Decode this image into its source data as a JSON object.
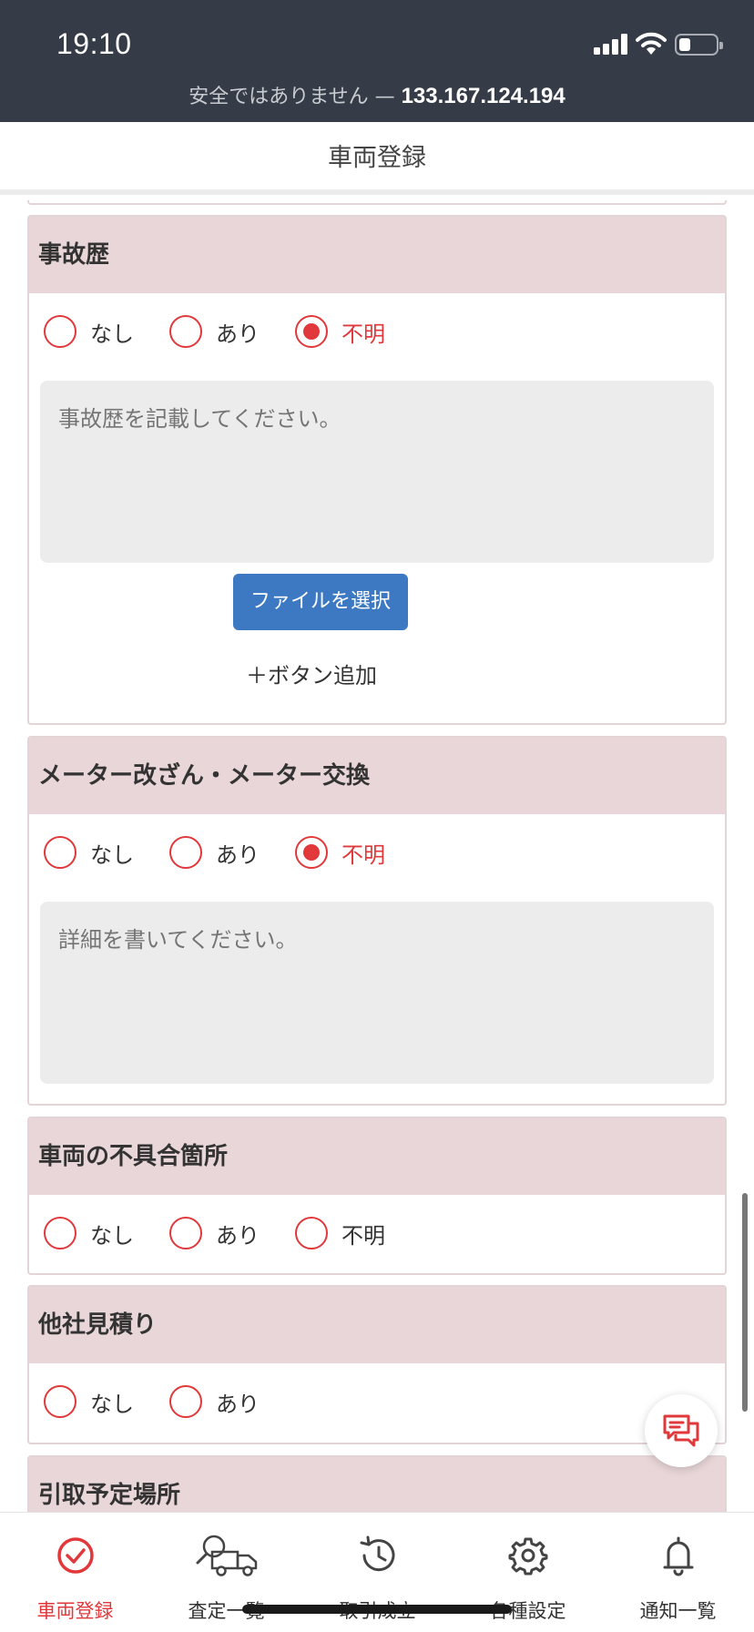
{
  "status_bar": {
    "time": "19:10"
  },
  "browser": {
    "insecure_text": "安全ではありません —",
    "host": "133.167.124.194"
  },
  "header": {
    "title": "車両登録"
  },
  "sections": [
    {
      "title": "事故歴",
      "options": [
        "なし",
        "あり",
        "不明"
      ],
      "selected": "不明",
      "placeholder": "事故歴を記載してください。",
      "file_button": "ファイルを選択",
      "add_button": "＋ボタン追加"
    },
    {
      "title": "メーター改ざん・メーター交換",
      "options": [
        "なし",
        "あり",
        "不明"
      ],
      "selected": "不明",
      "placeholder": "詳細を書いてください。"
    },
    {
      "title": "車両の不具合箇所",
      "options": [
        "なし",
        "あり",
        "不明"
      ],
      "selected": ""
    },
    {
      "title": "他社見積り",
      "options": [
        "なし",
        "あり"
      ],
      "selected": ""
    },
    {
      "title": "引取予定場所"
    }
  ],
  "nav": {
    "items": [
      {
        "label": "車両登録",
        "icon": "check-circle-icon",
        "active": true
      },
      {
        "label": "査定一覧",
        "icon": "truck-search-icon",
        "active": false
      },
      {
        "label": "取引成立",
        "icon": "history-icon",
        "active": false
      },
      {
        "label": "各種設定",
        "icon": "gear-icon",
        "active": false
      },
      {
        "label": "通知一覧",
        "icon": "bell-icon",
        "active": false
      }
    ]
  },
  "colors": {
    "accent": "#e0383b",
    "section_header": "#e8d6d8",
    "button": "#3d79c3",
    "status_bar": "#363c47"
  }
}
